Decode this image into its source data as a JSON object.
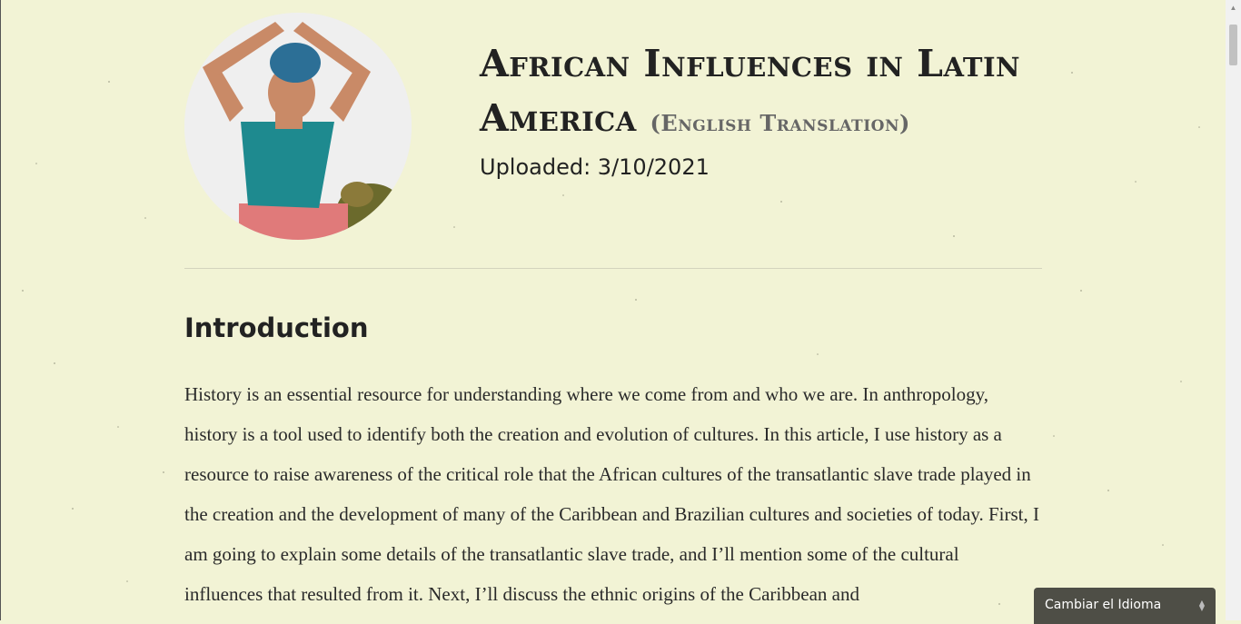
{
  "article": {
    "title": "African Influences in Latin America",
    "subtitle": "(English Translation)",
    "uploaded": "Uploaded: 3/10/2021",
    "section_title": "Introduction",
    "paragraph": "History is an essential resource for understanding where we come from and who we are. In anthropology, history is a tool used to identify both the creation and evolution of cultures. In this article, I use history as a resource to raise awareness of the critical role that the African cultures of the transatlantic slave trade played in the creation and the development of many of the Caribbean and Brazilian cultures and societies of today. First, I am going to explain some details of the transatlantic slave trade, and I’ll mention some of the cultural influences that resulted from it. Next, I’ll discuss the ethnic origins of the Caribbean and"
  },
  "language_selector": {
    "label": "Cambiar el Idioma"
  },
  "colors": {
    "background": "#f2f3d5",
    "text": "#222222",
    "selector_bg": "#4e4e46"
  }
}
